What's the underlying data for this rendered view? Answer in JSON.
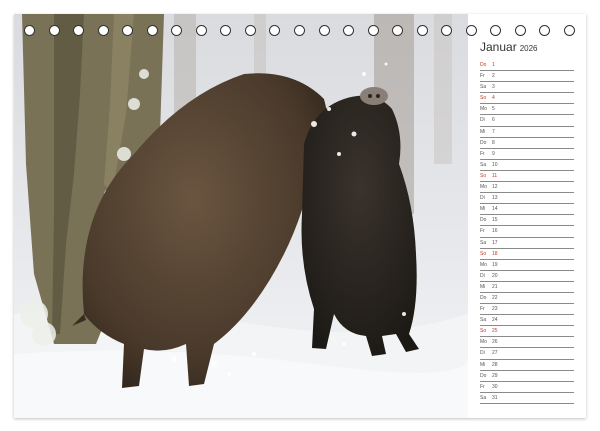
{
  "calendar": {
    "month": "Januar",
    "year": "2026",
    "days": [
      {
        "wd": "Do",
        "d": "1",
        "sun": true
      },
      {
        "wd": "Fr",
        "d": "2",
        "sun": false
      },
      {
        "wd": "Sa",
        "d": "3",
        "sun": false
      },
      {
        "wd": "So",
        "d": "4",
        "sun": true
      },
      {
        "wd": "Mo",
        "d": "5",
        "sun": false
      },
      {
        "wd": "Di",
        "d": "6",
        "sun": false
      },
      {
        "wd": "Mi",
        "d": "7",
        "sun": false
      },
      {
        "wd": "Do",
        "d": "8",
        "sun": false
      },
      {
        "wd": "Fr",
        "d": "9",
        "sun": false
      },
      {
        "wd": "Sa",
        "d": "10",
        "sun": false
      },
      {
        "wd": "So",
        "d": "11",
        "sun": true
      },
      {
        "wd": "Mo",
        "d": "12",
        "sun": false
      },
      {
        "wd": "Di",
        "d": "13",
        "sun": false
      },
      {
        "wd": "Mi",
        "d": "14",
        "sun": false
      },
      {
        "wd": "Do",
        "d": "15",
        "sun": false
      },
      {
        "wd": "Fr",
        "d": "16",
        "sun": false
      },
      {
        "wd": "Sa",
        "d": "17",
        "sun": false
      },
      {
        "wd": "So",
        "d": "18",
        "sun": true
      },
      {
        "wd": "Mo",
        "d": "19",
        "sun": false
      },
      {
        "wd": "Di",
        "d": "20",
        "sun": false
      },
      {
        "wd": "Mi",
        "d": "21",
        "sun": false
      },
      {
        "wd": "Do",
        "d": "22",
        "sun": false
      },
      {
        "wd": "Fr",
        "d": "23",
        "sun": false
      },
      {
        "wd": "Sa",
        "d": "24",
        "sun": false
      },
      {
        "wd": "So",
        "d": "25",
        "sun": true
      },
      {
        "wd": "Mo",
        "d": "26",
        "sun": false
      },
      {
        "wd": "Di",
        "d": "27",
        "sun": false
      },
      {
        "wd": "Mi",
        "d": "28",
        "sun": false
      },
      {
        "wd": "Do",
        "d": "29",
        "sun": false
      },
      {
        "wd": "Fr",
        "d": "30",
        "sun": false
      },
      {
        "wd": "Sa",
        "d": "31",
        "sun": false
      }
    ]
  },
  "colors": {
    "sunday": "#c0392b",
    "snow": "#eef0f3",
    "boar_fur": "#4a3a2b",
    "bark": "#7a7256"
  },
  "binding": {
    "ring_count": 23
  }
}
